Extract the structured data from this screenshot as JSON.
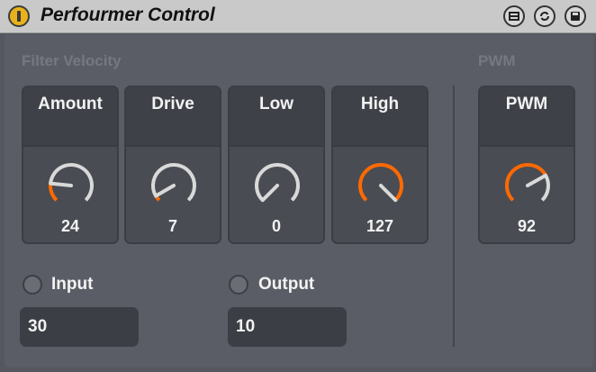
{
  "device": {
    "title": "Perfourmer Control",
    "buttons": [
      "fold-icon",
      "hot-swap-icon",
      "save-icon"
    ]
  },
  "filter_velocity": {
    "label": "Filter Velocity",
    "knobs": [
      {
        "label": "Amount",
        "value": "24",
        "min": 0,
        "max": 127
      },
      {
        "label": "Drive",
        "value": "7",
        "min": 0,
        "max": 127
      },
      {
        "label": "Low",
        "value": "0",
        "min": 0,
        "max": 127
      },
      {
        "label": "High",
        "value": "127",
        "min": 0,
        "max": 127
      }
    ],
    "input": {
      "label": "Input",
      "value": "30",
      "enabled": false
    },
    "output": {
      "label": "Output",
      "value": "10",
      "enabled": false
    }
  },
  "pwm": {
    "label": "PWM",
    "knob": {
      "label": "PWM",
      "value": "92",
      "min": 0,
      "max": 127
    }
  },
  "colors": {
    "accent": "#ff6a00",
    "knob_ring": "#d9d9d9",
    "power": "#e8b21c"
  }
}
